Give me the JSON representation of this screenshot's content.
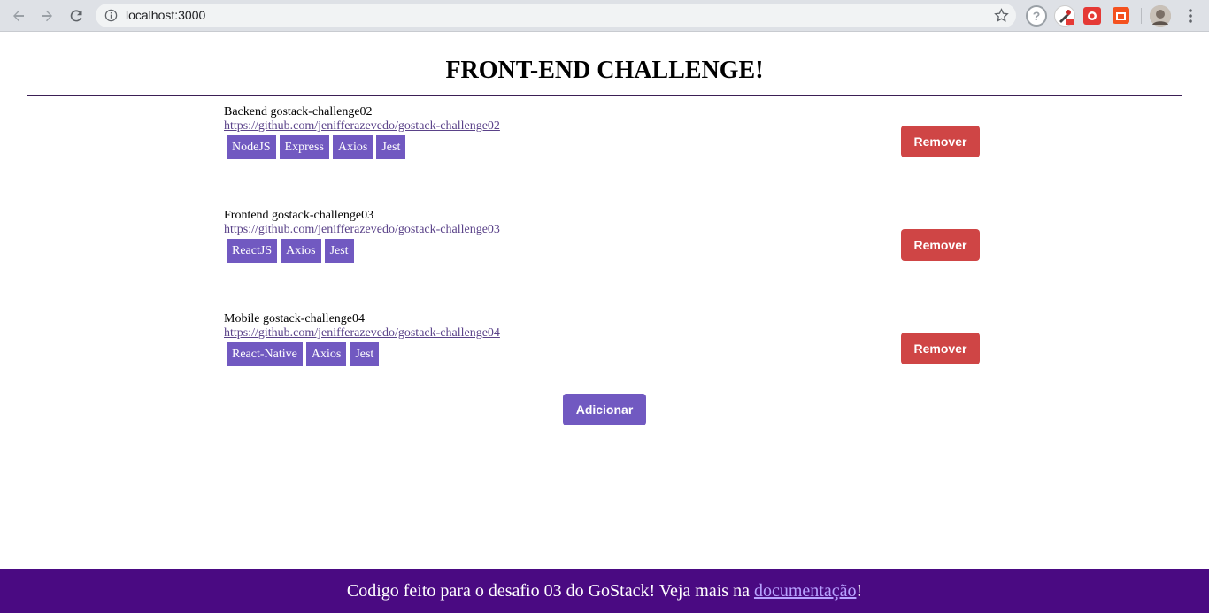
{
  "browser": {
    "url": "localhost:3000",
    "icons": [
      "back-icon",
      "forward-icon",
      "reload-icon",
      "info-icon",
      "star-icon",
      "help-icon",
      "extension-icon",
      "extension-icon",
      "extension-icon",
      "profile-avatar",
      "menu-icon"
    ]
  },
  "page": {
    "title": "FRONT-END CHALLENGE!",
    "repositories": [
      {
        "name": "Backend gostack-challenge02",
        "url": "https://github.com/jenifferazevedo/gostack-challenge02",
        "techs": [
          "NodeJS",
          "Express",
          "Axios",
          "Jest"
        ],
        "remove_label": "Remover"
      },
      {
        "name": "Frontend gostack-challenge03",
        "url": "https://github.com/jenifferazevedo/gostack-challenge03",
        "techs": [
          "ReactJS",
          "Axios",
          "Jest"
        ],
        "remove_label": "Remover"
      },
      {
        "name": "Mobile gostack-challenge04",
        "url": "https://github.com/jenifferazevedo/gostack-challenge04",
        "techs": [
          "React-Native",
          "Axios",
          "Jest"
        ],
        "remove_label": "Remover"
      }
    ],
    "add_label": "Adicionar"
  },
  "footer": {
    "text_before": "Codigo feito para o desafio 03 do GoStack! Veja mais na ",
    "link_text": "documentação",
    "text_after": "!"
  },
  "colors": {
    "accent": "#7159c1",
    "danger": "#cf4545",
    "footer_bg": "#4a0a82"
  }
}
